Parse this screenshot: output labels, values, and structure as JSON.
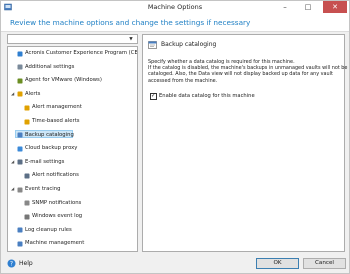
{
  "window": {
    "title": "Machine Options",
    "minimize": "–",
    "maximize": "□",
    "close": "✕"
  },
  "header": {
    "text": "Review the machine options and change the settings if necessary"
  },
  "search": {
    "value": "",
    "placeholder": ""
  },
  "tree": [
    {
      "label": "Acronis Customer Experience Program (CEP)",
      "icon": "cep-icon"
    },
    {
      "label": "Additional settings",
      "icon": "settings-icon"
    },
    {
      "label": "Agent for VMware (Windows)",
      "icon": "vmware-agent-icon"
    },
    {
      "label": "Alerts",
      "icon": "alerts-icon",
      "expander": "◢"
    },
    {
      "label": "Alert management",
      "icon": "alert-management-icon"
    },
    {
      "label": "Time-based alerts",
      "icon": "time-alerts-icon"
    },
    {
      "label": "Backup cataloging",
      "icon": "catalog-icon",
      "selected": true
    },
    {
      "label": "Cloud backup proxy",
      "icon": "cloud-proxy-icon"
    },
    {
      "label": "E-mail settings",
      "icon": "email-icon",
      "expander": "◢"
    },
    {
      "label": "Alert notifications",
      "icon": "alert-notifications-icon"
    },
    {
      "label": "Event tracing",
      "icon": "event-tracing-icon",
      "expander": "◢"
    },
    {
      "label": "SNMP notifications",
      "icon": "snmp-icon"
    },
    {
      "label": "Windows event log",
      "icon": "event-log-icon"
    },
    {
      "label": "Log cleanup rules",
      "icon": "log-cleanup-icon"
    },
    {
      "label": "Machine management",
      "icon": "machine-management-icon"
    }
  ],
  "option": {
    "title": "Backup cataloging",
    "description_lines": [
      "Specify whether a data catalog is required for this machine.",
      "If the catalog is disabled, the machine's backups in unmanaged vaults will not be",
      "cataloged. Also, the Data view will not display backed up data for any vault",
      "accessed from the machine."
    ],
    "checkbox_label": "Enable data catalog for this machine",
    "checkbox_checked": true,
    "check_mark": "✓"
  },
  "footer": {
    "help_label": "Help",
    "ok_label": "OK",
    "cancel_label": "Cancel"
  },
  "colors": {
    "accent": "#1e7fc4",
    "selection": "#cde6f7"
  }
}
